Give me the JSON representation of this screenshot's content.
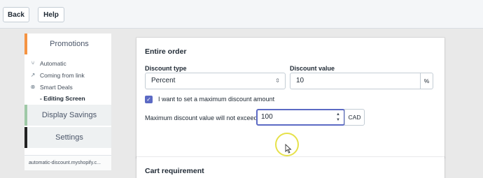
{
  "topbar": {
    "back_label": "Back",
    "help_label": "Help"
  },
  "sidebar": {
    "promotions_label": "Promotions",
    "sub_items": [
      {
        "icon": "split-icon",
        "label": "Automatic"
      },
      {
        "icon": "external-link-icon",
        "label": "Coming from link"
      },
      {
        "icon": "close-circle-icon",
        "label": "Smart Deals"
      }
    ],
    "editing_label": "- Editing Screen",
    "display_savings_label": "Display Savings",
    "settings_label": "Settings",
    "store_url": "automatic-discount.myshopify.c..."
  },
  "card": {
    "title": "Entire order",
    "discount_type_label": "Discount type",
    "discount_type_value": "Percent",
    "discount_value_label": "Discount value",
    "discount_value": "10",
    "discount_suffix": "%",
    "max_checkbox_label": "I want to set a maximum discount amount",
    "max_checked": true,
    "max_field_label": "Maximum discount value will not exceed",
    "max_field_value": "100",
    "currency_suffix": "CAD"
  },
  "card2": {
    "title": "Cart requirement"
  },
  "colors": {
    "accent": "#5c6ac4",
    "promotions_bar": "#f49342",
    "savings_bar": "#9fc9a6",
    "cursor_halo": "#e6e14a"
  }
}
